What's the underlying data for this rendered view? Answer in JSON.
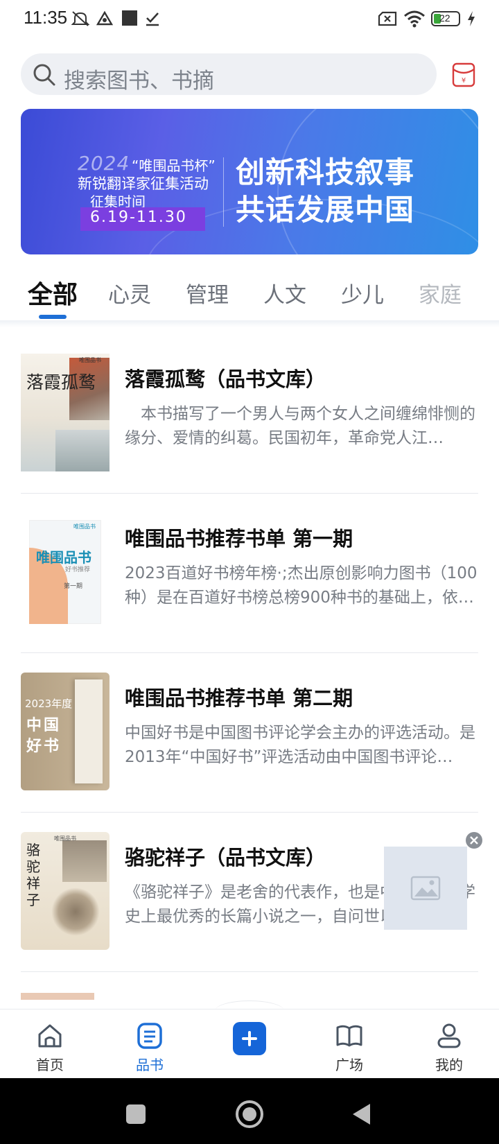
{
  "status_bar": {
    "time": "11:35",
    "battery": "22"
  },
  "search": {
    "placeholder": "搜索图书、书摘"
  },
  "banner": {
    "year": "2024",
    "cup": "“唯围品书杯”",
    "subtitle": "新锐翻译家征集活动",
    "period_label": "征集时间",
    "dates": "6.19-11.30",
    "headline_1": "创新科技叙事",
    "headline_2": "共话发展中国"
  },
  "tabs": [
    {
      "label": "全部",
      "active": true
    },
    {
      "label": "心灵"
    },
    {
      "label": "管理"
    },
    {
      "label": "人文"
    },
    {
      "label": "少儿"
    },
    {
      "label": "家庭"
    }
  ],
  "books": [
    {
      "title": "落霞孤鹜（品书文库）",
      "description": "　本书描写了一个男人与两个女人之间缠绵悱恻的缘分、爱情的纠葛。民国初年，革命党人江…",
      "cover_text": "落霞孤鹜",
      "cover_brand": "唯围品书"
    },
    {
      "title": "唯围品书推荐书单 第一期",
      "description": "2023百道好书榜年榜·;杰出原创影响力图书（100种）是在百道好书榜总榜900种书的基础上，依…",
      "cover_text": "唯围品书",
      "cover_sub": "好书推荐",
      "cover_issue": "第一期",
      "cover_brand": "唯围品书"
    },
    {
      "title": "唯围品书推荐书单 第二期",
      "description": "中国好书是中国图书评论学会主办的评选活动。是2013年“中国好书”评选活动由中国图书评论…",
      "cover_year": "2023年度",
      "cover_line1": "中国",
      "cover_line2": "好书"
    },
    {
      "title": "骆驼祥子（品书文库）",
      "description": "《骆驼祥子》是老舍的代表作，也是中国现代文学史上最优秀的长篇小说之一，自问世以来…",
      "cover_text": "骆驼祥子",
      "cover_brand": "唯围品书"
    }
  ],
  "bottom_nav": [
    {
      "label": "首页",
      "icon": "home-icon"
    },
    {
      "label": "品书",
      "icon": "book-list-icon",
      "active": true
    },
    {
      "label": "",
      "icon": "plus-icon"
    },
    {
      "label": "广场",
      "icon": "open-book-icon"
    },
    {
      "label": "我的",
      "icon": "profile-icon"
    }
  ],
  "colors": {
    "accent": "#1e6fd6",
    "text_primary": "#111111",
    "text_secondary": "#777c84"
  }
}
